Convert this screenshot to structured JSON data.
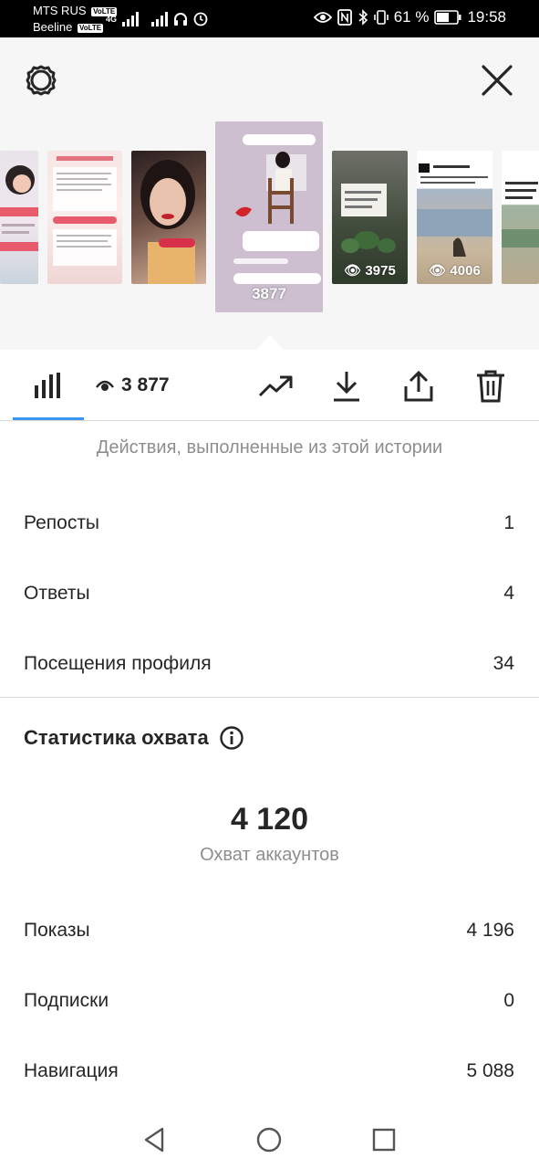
{
  "status_bar": {
    "carrier1": "MTS RUS",
    "carrier2": "Beeline",
    "volte": "VoLTE",
    "network": "4G",
    "battery": "61 %",
    "time": "19:58"
  },
  "header": {
    "settings_icon": "gear-icon",
    "close_icon": "close-icon"
  },
  "stories": [
    {
      "views": "",
      "selected": false
    },
    {
      "views": "",
      "selected": false
    },
    {
      "views": "",
      "selected": false
    },
    {
      "views": "3877",
      "selected": true
    },
    {
      "views": "3975",
      "selected": false
    },
    {
      "views": "4006",
      "selected": false
    },
    {
      "views": "",
      "selected": false
    }
  ],
  "toolbar": {
    "views_count": "3 877",
    "icons": [
      "bar-chart-icon",
      "eye-icon",
      "trending-up-icon",
      "download-icon",
      "share-icon",
      "trash-icon"
    ]
  },
  "interactions": {
    "subtitle": "Действия, выполненные из этой истории",
    "rows": [
      {
        "label": "Репосты",
        "value": "1"
      },
      {
        "label": "Ответы",
        "value": "4"
      },
      {
        "label": "Посещения профиля",
        "value": "34"
      }
    ]
  },
  "reach": {
    "title": "Статистика охвата",
    "accounts_reached": "4 120",
    "accounts_reached_label": "Охват аккаунтов",
    "rows": [
      {
        "label": "Показы",
        "value": "4 196"
      },
      {
        "label": "Подписки",
        "value": "0"
      },
      {
        "label": "Навигация",
        "value": "5 088"
      }
    ]
  },
  "colors": {
    "accent": "#3897f0",
    "text": "#262626",
    "secondary_text": "#8e8e8e",
    "divider": "#dbdbdb",
    "top_background": "#f6f6f6"
  }
}
